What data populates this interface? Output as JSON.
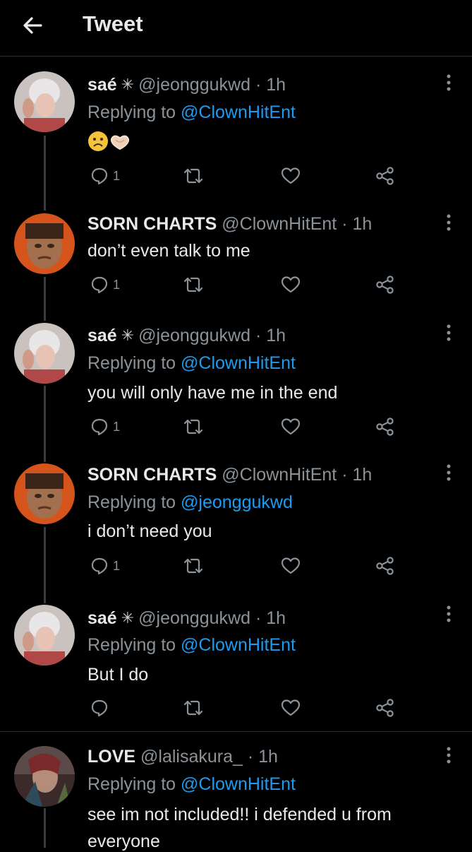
{
  "header": {
    "title": "Tweet",
    "back_icon": "arrow-left-icon"
  },
  "colors": {
    "background": "#000000",
    "link": "#1d9bf0",
    "muted": "#8b9298",
    "text": "#e7e9ea"
  },
  "tweets": [
    {
      "name": "saé",
      "name_emoji": "🕷",
      "handle": "@jeonggukwd",
      "dot": "·",
      "time": "1h",
      "reply_prefix": "Replying to",
      "reply_to": "@ClownHitEnt",
      "text": "",
      "emoji_content": [
        "sad-face",
        "heart-hands"
      ],
      "reply_count": "1"
    },
    {
      "name": "SORN CHARTS",
      "name_emoji": "",
      "handle": "@ClownHitEnt",
      "dot": "·",
      "time": "1h",
      "reply_prefix": "",
      "reply_to": "",
      "text": "don’t even talk to me",
      "reply_count": "1"
    },
    {
      "name": "saé",
      "name_emoji": "🕷",
      "handle": "@jeonggukwd",
      "dot": "·",
      "time": "1h",
      "reply_prefix": "Replying to",
      "reply_to": "@ClownHitEnt",
      "text": "you will only have me in the end",
      "reply_count": "1"
    },
    {
      "name": "SORN CHARTS",
      "name_emoji": "",
      "handle": "@ClownHitEnt",
      "dot": "·",
      "time": "1h",
      "reply_prefix": "Replying to",
      "reply_to": "@jeonggukwd",
      "text": "i don’t need you",
      "reply_count": "1"
    },
    {
      "name": "saé",
      "name_emoji": "🕷",
      "handle": "@jeonggukwd",
      "dot": "·",
      "time": "1h",
      "reply_prefix": "Replying to",
      "reply_to": "@ClownHitEnt",
      "text": "But I do",
      "reply_count": ""
    },
    {
      "name": "LOVE",
      "name_emoji": "",
      "handle": "@lalisakura_",
      "dot": "·",
      "time": "1h",
      "reply_prefix": "Replying to",
      "reply_to": "@ClownHitEnt",
      "text": "see im not included!! i defended u from",
      "text2": "everyone",
      "reply_count": ""
    }
  ]
}
